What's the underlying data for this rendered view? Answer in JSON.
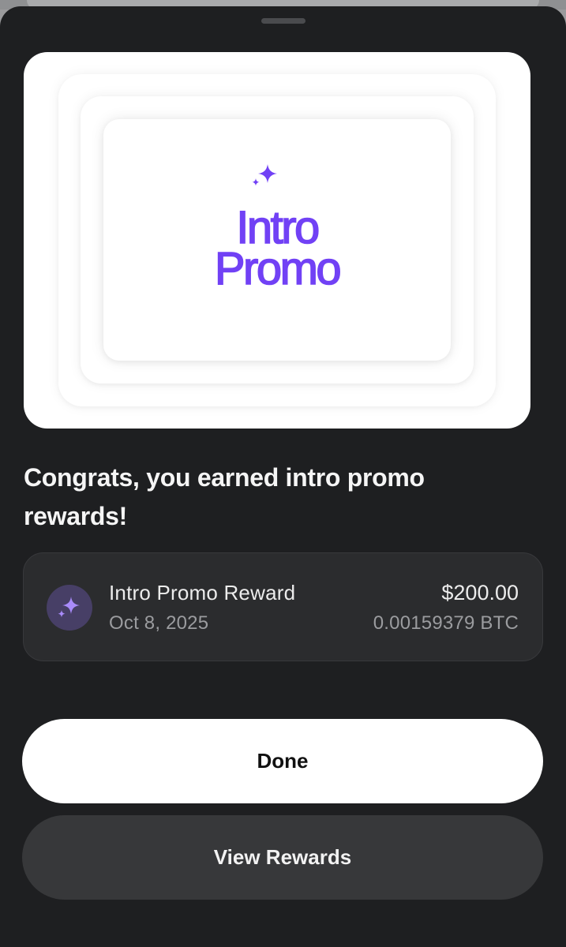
{
  "promo_card": {
    "title_line1": "Intro",
    "title_line2": "Promo",
    "icon": "sparkle-icon",
    "accent_color": "#7141f5"
  },
  "headline": "Congrats, you earned intro promo rewards!",
  "reward": {
    "icon": "sparkle-icon",
    "name": "Intro Promo Reward",
    "date": "Oct 8, 2025",
    "amount": "$200.00",
    "crypto_amount": "0.00159379 BTC"
  },
  "buttons": {
    "done_label": "Done",
    "view_rewards_label": "View Rewards"
  },
  "colors": {
    "sheet_background": "#1e1f21",
    "card_background": "#2b2c2e",
    "secondary_button": "#37383a"
  }
}
